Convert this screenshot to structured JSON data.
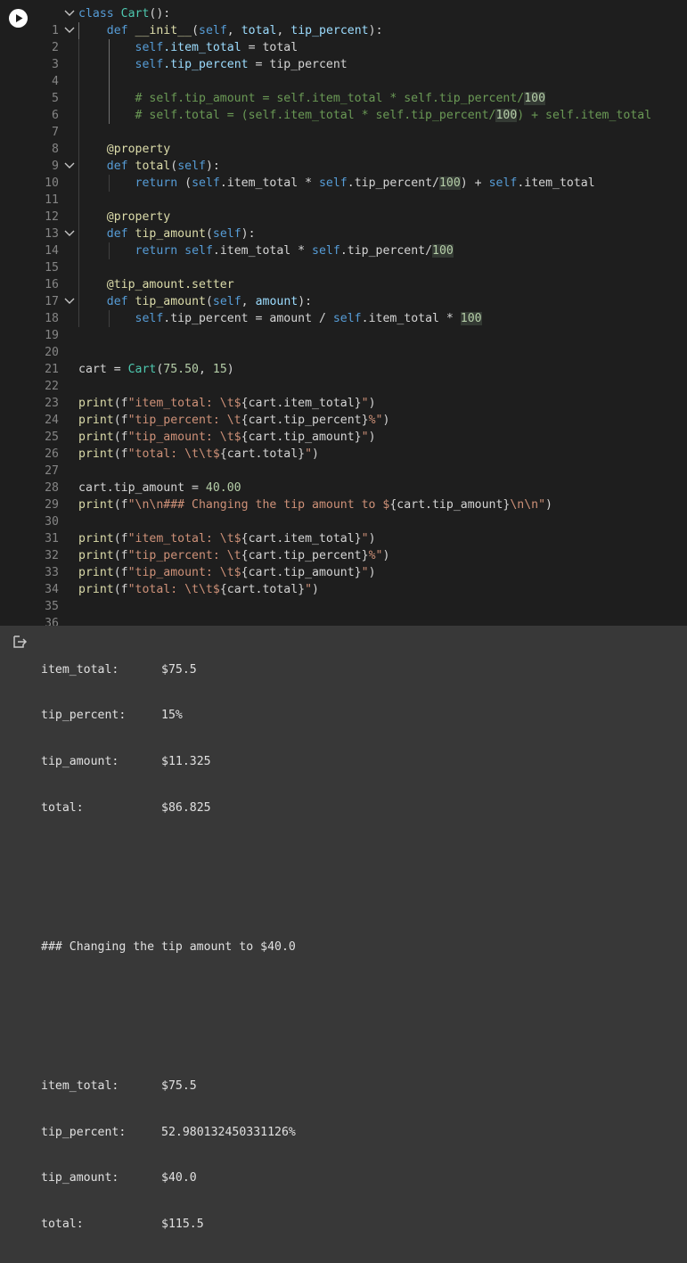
{
  "code_lines": [
    {
      "n": "1"
    },
    {
      "n": "2"
    },
    {
      "n": "3"
    },
    {
      "n": "4"
    },
    {
      "n": "5"
    },
    {
      "n": "6"
    },
    {
      "n": "7"
    },
    {
      "n": "8"
    },
    {
      "n": "9"
    },
    {
      "n": "10"
    },
    {
      "n": "11"
    },
    {
      "n": "12"
    },
    {
      "n": "13"
    },
    {
      "n": "14"
    },
    {
      "n": "15"
    },
    {
      "n": "16"
    },
    {
      "n": "17"
    },
    {
      "n": "18"
    },
    {
      "n": "19"
    },
    {
      "n": "20"
    },
    {
      "n": "21"
    },
    {
      "n": "22"
    },
    {
      "n": "23"
    },
    {
      "n": "24"
    },
    {
      "n": "25"
    },
    {
      "n": "26"
    },
    {
      "n": "27"
    },
    {
      "n": "28"
    },
    {
      "n": "29"
    },
    {
      "n": "30"
    },
    {
      "n": "31"
    },
    {
      "n": "32"
    },
    {
      "n": "33"
    },
    {
      "n": "34"
    },
    {
      "n": "35"
    },
    {
      "n": "36"
    }
  ],
  "code": {
    "l1": {
      "kw": "class",
      "name": "Cart",
      "rest": "():"
    },
    "l2": {
      "kw": "def",
      "name": "__init__",
      "p1": "self",
      "p2": "total",
      "p3": "tip_percent",
      "end": "):"
    },
    "l3": {
      "self": "self",
      "attr": ".item_total",
      "eq": " = total"
    },
    "l4": {
      "self": "self",
      "attr": ".tip_percent",
      "eq": " = tip_percent"
    },
    "l6": {
      "comment": "# self.tip_amount = self.item_total * self.tip_percent/",
      "num": "100"
    },
    "l7": {
      "comment_a": "# self.total = (self.item_total * self.tip_percent/",
      "num": "100",
      "comment_b": ") + self.item_total"
    },
    "l9": {
      "deco": "@property"
    },
    "l10": {
      "kw": "def",
      "name": "total",
      "p1": "self",
      "end": "):"
    },
    "l11": {
      "kw": "return",
      "a": " (",
      "self1": "self",
      "b": ".item_total * ",
      "self2": "self",
      "c": ".tip_percent/",
      "num": "100",
      "d": ") + ",
      "self3": "self",
      "e": ".item_total"
    },
    "l13": {
      "deco": "@property"
    },
    "l14": {
      "kw": "def",
      "name": "tip_amount",
      "p1": "self",
      "end": "):"
    },
    "l15": {
      "kw": "return",
      "self1": "self",
      "b": ".item_total * ",
      "self2": "self",
      "c": ".tip_percent/",
      "num": "100"
    },
    "l17": {
      "deco": "@tip_amount.setter"
    },
    "l18": {
      "kw": "def",
      "name": "tip_amount",
      "p1": "self",
      "p2": "amount",
      "end": "):"
    },
    "l19": {
      "self1": "self",
      "a": ".tip_percent = amount / ",
      "self2": "self",
      "b": ".item_total * ",
      "num": "100"
    },
    "l22": {
      "a": "cart = ",
      "cls": "Cart",
      "b": "(",
      "n1": "75.50",
      "c": ", ",
      "n2": "15",
      "d": ")"
    },
    "l24": {
      "fn": "print",
      "pre": "(f",
      "s1": "\"item_total: \\t$",
      "expr": "{cart.item_total}",
      "s2": "\"",
      "post": ")"
    },
    "l25": {
      "fn": "print",
      "pre": "(f",
      "s1": "\"tip_percent: \\t",
      "expr": "{cart.tip_percent}",
      "s2": "%\"",
      "post": ")"
    },
    "l26": {
      "fn": "print",
      "pre": "(f",
      "s1": "\"tip_amount: \\t$",
      "expr": "{cart.tip_amount}",
      "s2": "\"",
      "post": ")"
    },
    "l27": {
      "fn": "print",
      "pre": "(f",
      "s1": "\"total: \\t\\t$",
      "expr": "{cart.total}",
      "s2": "\"",
      "post": ")"
    },
    "l29": {
      "a": "cart.tip_amount = ",
      "num": "40.00"
    },
    "l30": {
      "fn": "print",
      "pre": "(f",
      "s1": "\"\\n\\n### Changing the tip amount to $",
      "expr": "{cart.tip_amount}",
      "s2": "\\n\\n\"",
      "post": ")"
    },
    "l32": {
      "fn": "print",
      "pre": "(f",
      "s1": "\"item_total: \\t$",
      "expr": "{cart.item_total}",
      "s2": "\"",
      "post": ")"
    },
    "l33": {
      "fn": "print",
      "pre": "(f",
      "s1": "\"tip_percent: \\t",
      "expr": "{cart.tip_percent}",
      "s2": "%\"",
      "post": ")"
    },
    "l34": {
      "fn": "print",
      "pre": "(f",
      "s1": "\"tip_amount: \\t$",
      "expr": "{cart.tip_amount}",
      "s2": "\"",
      "post": ")"
    },
    "l35": {
      "fn": "print",
      "pre": "(f",
      "s1": "\"total: \\t\\t$",
      "expr": "{cart.total}",
      "s2": "\"",
      "post": ")"
    }
  },
  "output": {
    "block1": [
      {
        "key": "item_total:",
        "val": "$75.5"
      },
      {
        "key": "tip_percent:",
        "val": "15%"
      },
      {
        "key": "tip_amount:",
        "val": "$11.325"
      },
      {
        "key": "total:",
        "val": "$86.825"
      }
    ],
    "heading": "### Changing the tip amount to $40.0",
    "block2": [
      {
        "key": "item_total:",
        "val": "$75.5"
      },
      {
        "key": "tip_percent:",
        "val": "52.980132450331126%"
      },
      {
        "key": "tip_amount:",
        "val": "$40.0"
      },
      {
        "key": "total:",
        "val": "$115.5"
      }
    ]
  },
  "icons": {
    "run": "play-circle-icon",
    "output": "output-icon",
    "fold": "chevron-down-icon"
  }
}
